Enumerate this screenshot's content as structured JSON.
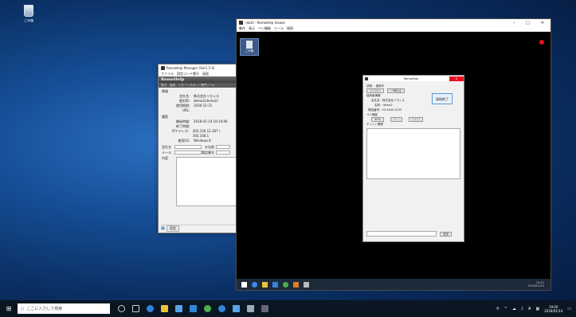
{
  "desktop": {
    "recycle_label": "ごみ箱"
  },
  "manager": {
    "title": "RemoHelp Manager (Ver1.5.0)",
    "menu": [
      "ファイル",
      "設定コード番号",
      "画面"
    ],
    "brand": "RemoHelp",
    "tabs": [
      "受付",
      "接続",
      "リモートサポート専門ツール"
    ],
    "info_heading": "情報",
    "info": [
      {
        "k": "会社名：",
        "v": "株式会社リモシス"
      },
      {
        "k": "使用ID：",
        "v": "demo2(demo2)"
      },
      {
        "k": "使用期限：",
        "v": "2030-12-31"
      },
      {
        "k": "URL：",
        "v": ""
      }
    ],
    "history_heading": "履歴",
    "history": [
      {
        "k": "開始時間：",
        "v": "2018-01-14 19:10:46"
      },
      {
        "k": "終了時間：",
        "v": ""
      },
      {
        "k": "IPアドレス：",
        "v": "202.150.12.187 / 192.168.1"
      },
      {
        "k": "使用OS：",
        "v": "Windows 8"
      }
    ],
    "company_label": "会社名",
    "name_label": "お名前",
    "mail_label": "メール",
    "phone_label": "電話番号",
    "content_label": "内容",
    "settings_button": "設定"
  },
  "viewer": {
    "title": "rdat3 - RemoHelp Viewer",
    "menu": [
      "動作",
      "表示",
      "ペン機能",
      "ツール",
      "接続"
    ],
    "remote_icon_label": "ごみ箱",
    "dialog": {
      "title": "RemoHelp",
      "status_label": "状態：",
      "status_value": "接続中",
      "connect_btn": "接続開始",
      "pause_btn": "一時中止",
      "end_btn": "接続終了",
      "connector_heading": "接続者情報",
      "company": "会社名：株式会社リモシス",
      "name": "名前：demo2",
      "phone": "電話番号：03-4405-4135",
      "pen_heading": "ペン機能",
      "pen_btns": [
        "50%",
        "停止",
        "全削除"
      ],
      "chat_heading": "チャット履歴",
      "send_btn": "送信"
    },
    "remote_clock": [
      "19:21",
      "2018/01/14"
    ]
  },
  "taskbar": {
    "search_placeholder": "ここに入力して検索",
    "clock_time": "19:00",
    "clock_date": "2018/01/14",
    "ime": "A"
  }
}
